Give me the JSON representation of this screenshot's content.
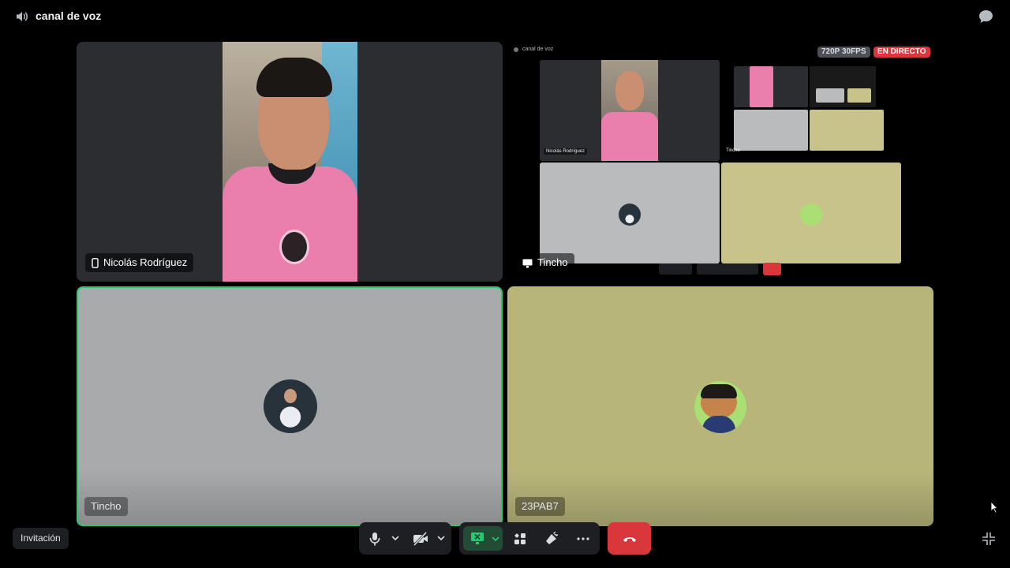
{
  "window": {
    "channel_title": "canal de voz",
    "icons": {
      "speaker": "speaker-icon",
      "chat": "chat-icon"
    }
  },
  "tiles": {
    "camera": {
      "name": "Nicolás Rodríguez",
      "device_icon": "mobile-icon"
    },
    "stream": {
      "name": "Tincho",
      "device_icon": "monitor-icon",
      "resolution_badge": "720P 30FPS",
      "live_badge": "EN DIRECTO",
      "preview": {
        "title": "canal de voz",
        "tile1_name": "Nicolás Rodríguez",
        "tile2_name": "Tincho"
      }
    },
    "voice1": {
      "name": "Tincho",
      "speaking": true,
      "avatar": "player-avatar"
    },
    "voice2": {
      "name": "23PAB7",
      "speaking": false,
      "avatar": "cartoon-avatar"
    }
  },
  "controls": {
    "invite_label": "Invitación",
    "buttons": [
      "microphone-icon",
      "camera-off-icon",
      "screen-share-icon",
      "activities-icon",
      "soundboard-icon",
      "more-icon",
      "end-call-icon"
    ],
    "shrink_icon": "exit-fullscreen-icon"
  },
  "colors": {
    "background": "#000000",
    "speaking_ring": "#2dc770",
    "end_call": "#da373c",
    "live_badge": "#da373c",
    "screen_share_active": "#234c36"
  }
}
